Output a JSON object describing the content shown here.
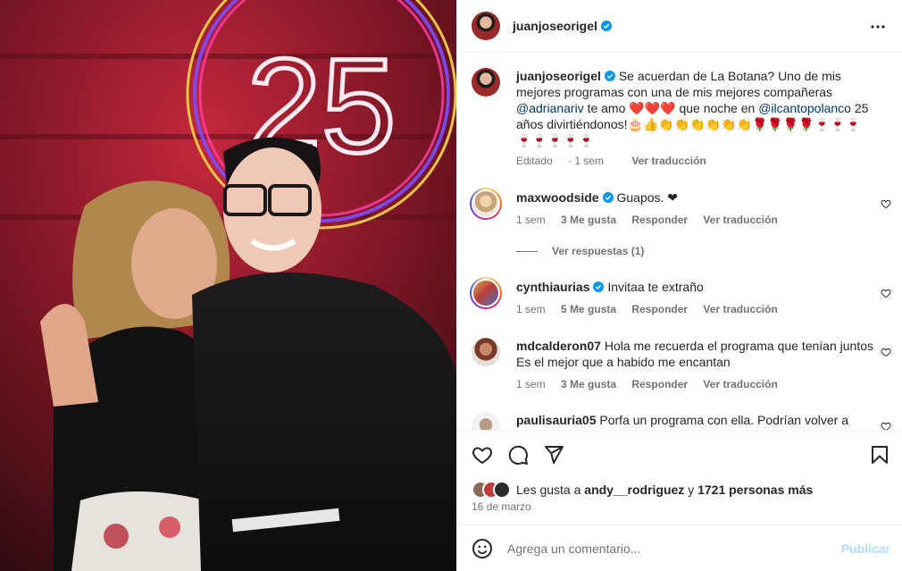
{
  "colors": {
    "accent": "#0095f6",
    "link": "#00376b",
    "muted": "#737373",
    "verified": "#0095f6"
  },
  "photo": {
    "neon_text": "25"
  },
  "post": {
    "author": "juanjoseorigel",
    "verified": true,
    "caption_part1": "Se acuerdan de La Botana? Uno de mis mejores programas con una de mis mejores compañeras",
    "mention1": "@adrianariv",
    "caption_part2": "te amo ❤️❤️❤️ que noche en",
    "mention2": "@ilcantopolanco",
    "caption_part3": "25 años divirtiéndonos!🎂👍👏👏👏👏👏👏🌹🌹🌹🌹🍷🍷🍷🍷🍷🍷🍷🍷",
    "edited_label": "Editado",
    "time": "1 sem",
    "translate": "Ver traducción"
  },
  "comments": [
    {
      "user": "maxwoodside",
      "verified": true,
      "text": "Guapos. ❤",
      "time": "1 sem",
      "likes": "",
      "reply": "Responder",
      "translate": "Ver traducción",
      "view_replies": "Ver respuestas (1)"
    },
    {
      "user": "cynthiaurias",
      "verified": true,
      "text": "Invitaa te extraño",
      "time": "1 sem",
      "likes": "5 Me gusta",
      "reply": "Responder",
      "translate": "Ver traducción"
    },
    {
      "user": "mdcalderon07",
      "verified": false,
      "text": "Hola me recuerda el programa que tenían juntos Es el mejor que a habido me encantan",
      "time": "1 sem",
      "likes": "3 Me gusta",
      "reply": "Responder",
      "translate": "Ver traducción"
    },
    {
      "user": "paulisauria05",
      "verified": false,
      "text": "Porfa un programa con ella. Podrían volver a"
    }
  ],
  "likes_summary": {
    "prefix": "Les gusta a",
    "user": "andy__rodriguez",
    "conj": "y",
    "count": "1721 personas más"
  },
  "post_date": "16 de marzo",
  "add_comment": {
    "placeholder": "Agrega un comentario...",
    "publish": "Publicar"
  },
  "icons": [
    "heart-icon",
    "comment-icon",
    "share-icon",
    "bookmark-icon",
    "emoji-icon",
    "more-icon",
    "verified-badge-icon"
  ]
}
